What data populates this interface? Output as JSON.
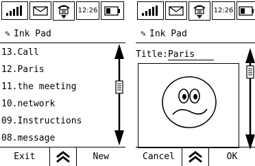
{
  "status": {
    "time": "12:26"
  },
  "screen1": {
    "app_title": "Ink Pad",
    "items": [
      {
        "label": "13.Call"
      },
      {
        "label": "12.Paris"
      },
      {
        "label": "11.the meeting"
      },
      {
        "label": "10.network"
      },
      {
        "label": "09.Instructions"
      },
      {
        "label": "08.message"
      }
    ],
    "softkeys": {
      "left": "Exit",
      "right": "New"
    }
  },
  "screen2": {
    "app_title": "Ink Pad",
    "title_label": "Title:",
    "title_value": "Paris",
    "softkeys": {
      "left": "Cancel",
      "right": "OK"
    }
  }
}
